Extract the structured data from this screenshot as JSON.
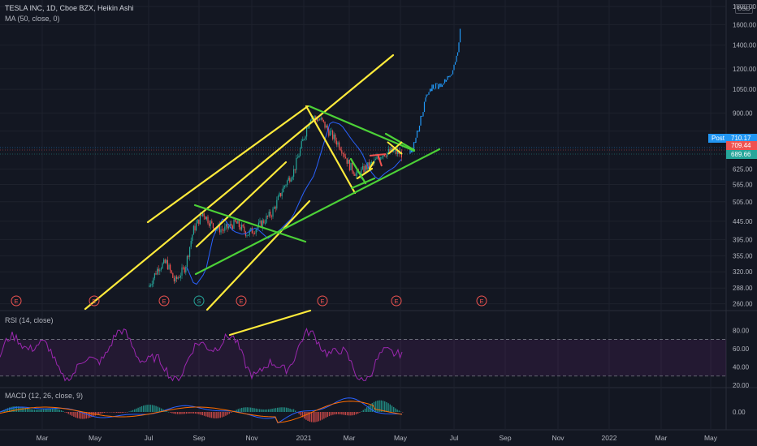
{
  "header": {
    "title": "TESLA INC, 1D, Cboe BZX, Heikin Ashi",
    "ma_label": "MA (50, close, 0)",
    "currency": "USD"
  },
  "colors": {
    "background": "#131722",
    "grid": "#1e222d",
    "text": "#b2b5be",
    "yellow_lines": "#ffeb3b",
    "green_lines": "#4cd137",
    "ha_up": "#26a69a",
    "ha_down": "#ef5350",
    "projection": "#2196f3",
    "rsi": "#9c27b0",
    "macd_line": "#2962ff",
    "signal_line": "#ff6d00"
  },
  "price_axis": {
    "ticks": [
      "1800.00",
      "1600.00",
      "1400.00",
      "1200.00",
      "1050.00",
      "900.00",
      "800.00",
      "709.44",
      "625.00",
      "565.00",
      "505.00",
      "445.00",
      "395.00",
      "355.00",
      "320.00",
      "288.00",
      "260.00"
    ]
  },
  "price_badges": [
    {
      "label": "Post",
      "value": "710.17",
      "color": "#2196f3"
    },
    {
      "value": "709.44",
      "color": "#ef5350"
    },
    {
      "value": "689.66",
      "color": "#26a69a"
    }
  ],
  "rsi": {
    "label": "RSI (14, close)",
    "ticks": [
      "80.00",
      "60.00",
      "40.00",
      "20.00"
    ]
  },
  "macd": {
    "label": "MACD (12, 26, close, 9)",
    "ticks": [
      "0.00"
    ]
  },
  "time_axis": [
    "Mar",
    "May",
    "Jul",
    "Sep",
    "Nov",
    "2021",
    "Mar",
    "May",
    "Jul",
    "Sep",
    "Nov",
    "2022",
    "Mar",
    "May"
  ],
  "events": [
    "E",
    "E",
    "E",
    "S",
    "E",
    "E",
    "E",
    "E"
  ],
  "chart_data": [
    {
      "type": "line",
      "title": "TESLA INC, 1D, Cboe BZX, Heikin Ashi",
      "scale": "log",
      "x": [
        "2020-07",
        "2020-08",
        "2020-09",
        "2020-10",
        "2020-11",
        "2020-12",
        "2021-01",
        "2021-02",
        "2021-03",
        "2021-04",
        "2021-05",
        "2021-06",
        "2021-07"
      ],
      "series": [
        {
          "name": "",
          "values": [
            290,
            430,
            410,
            420,
            430,
            620,
            860,
            800,
            620,
            680,
            709.44,
            1000,
            1550
          ]
        }
      ],
      "ylim": [
        250,
        1800
      ],
      "y_ticks": [
        288,
        320,
        355,
        395,
        445,
        505,
        565,
        625,
        709.44,
        800,
        900,
        1050,
        1200,
        1400,
        1600,
        1800
      ],
      "grid": true
    },
    {
      "type": "line",
      "title": "RSI (14, close)",
      "ylim": [
        20,
        90
      ],
      "y_ticks": [
        80,
        60,
        40,
        20
      ],
      "grid": true
    },
    {
      "type": "bar",
      "title": "MACD (12, 26, close, 9)",
      "y_ticks": [
        0
      ],
      "grid": true
    }
  ]
}
